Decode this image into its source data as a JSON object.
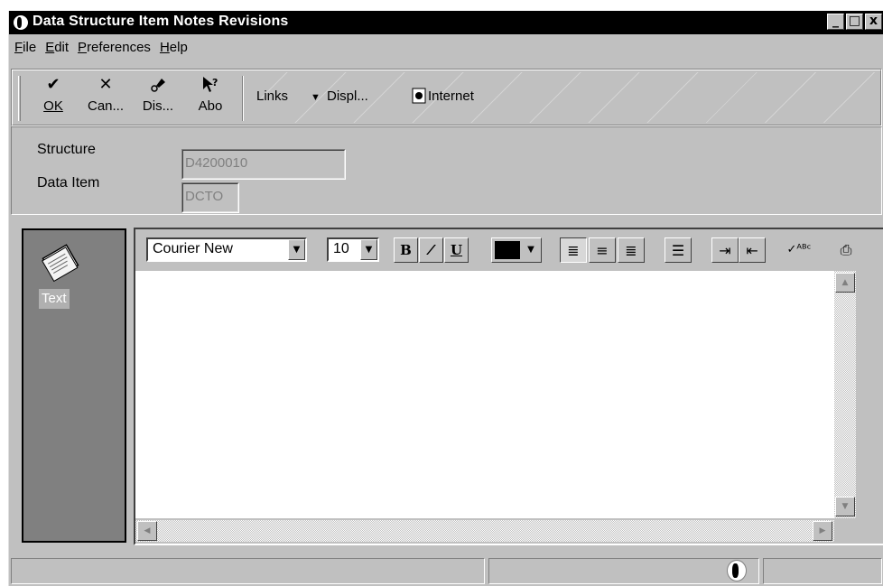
{
  "window": {
    "title": "Data Structure Item Notes Revisions",
    "controls": {
      "minimize": "_",
      "maximize": "□",
      "close": "x"
    }
  },
  "menu": [
    {
      "label": "File",
      "mnemonic": "F"
    },
    {
      "label": "Edit",
      "mnemonic": "E"
    },
    {
      "label": "Preferences",
      "mnemonic": "P"
    },
    {
      "label": "Help",
      "mnemonic": "H"
    }
  ],
  "toolbar": {
    "ok": {
      "label": "OK",
      "icon": "check-icon"
    },
    "cancel": {
      "label": "Can...",
      "icon": "cancel-x-icon"
    },
    "display": {
      "label": "Dis...",
      "icon": "display-tool-icon"
    },
    "about": {
      "label": "Abo",
      "icon": "whats-this-icon"
    },
    "links": "Links",
    "display_menu": "Displ...",
    "internet": "Internet"
  },
  "form": {
    "structure_label": "Structure",
    "structure_value": "D4200010",
    "data_item_label": "Data Item",
    "data_item_value": "DCTO"
  },
  "side_tab": {
    "label": "Text",
    "icon": "notepad-icon"
  },
  "editor": {
    "font_name": "Courier New",
    "font_size": "10",
    "bold": "B",
    "italic": "I",
    "underline": "U",
    "text_color": "#000000",
    "alignment": "left",
    "content": ""
  }
}
